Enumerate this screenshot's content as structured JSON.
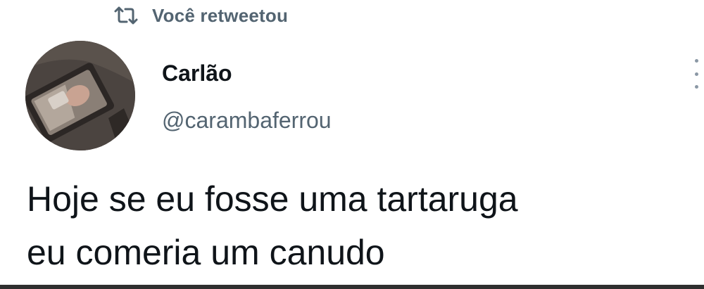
{
  "retweet_banner": {
    "icon": "retweet-icon",
    "text": "Você retweetou"
  },
  "author": {
    "display_name": "Carlão",
    "handle": "@carambaferrou"
  },
  "tweet": {
    "lines": [
      "Hoje se eu fosse uma tartaruga",
      "eu comeria um canudo"
    ]
  },
  "colors": {
    "text_primary": "#0f1419",
    "text_secondary": "#536471"
  }
}
